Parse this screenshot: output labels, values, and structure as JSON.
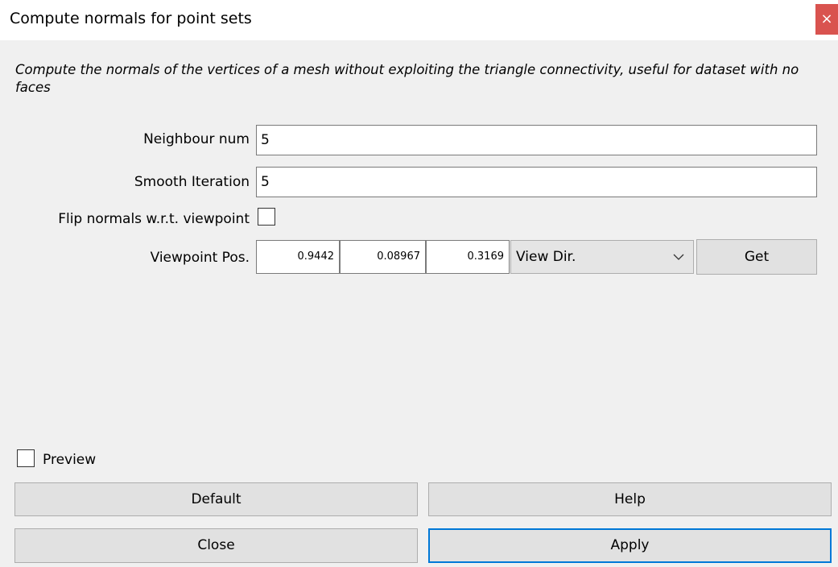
{
  "window": {
    "title": "Compute normals for point sets",
    "close_glyph": "×"
  },
  "description": "Compute the normals of the vertices of a mesh without exploiting the triangle connectivity, useful for dataset with no faces",
  "params": {
    "neighbour_num": {
      "label": "Neighbour num",
      "value": "5"
    },
    "smooth_iteration": {
      "label": "Smooth Iteration",
      "value": "5"
    },
    "flip_normals": {
      "label": "Flip normals w.r.t. viewpoint",
      "checked": false
    },
    "viewpoint": {
      "label": "Viewpoint Pos.",
      "x": "0.9442",
      "y": "0.08967",
      "z": "0.3169",
      "mode": "View Dir.",
      "get_label": "Get"
    }
  },
  "preview": {
    "label": "Preview",
    "checked": false
  },
  "buttons": {
    "default": "Default",
    "help": "Help",
    "close": "Close",
    "apply": "Apply"
  },
  "colors": {
    "close_button": "#d9534f",
    "focus_border": "#0078d7"
  }
}
